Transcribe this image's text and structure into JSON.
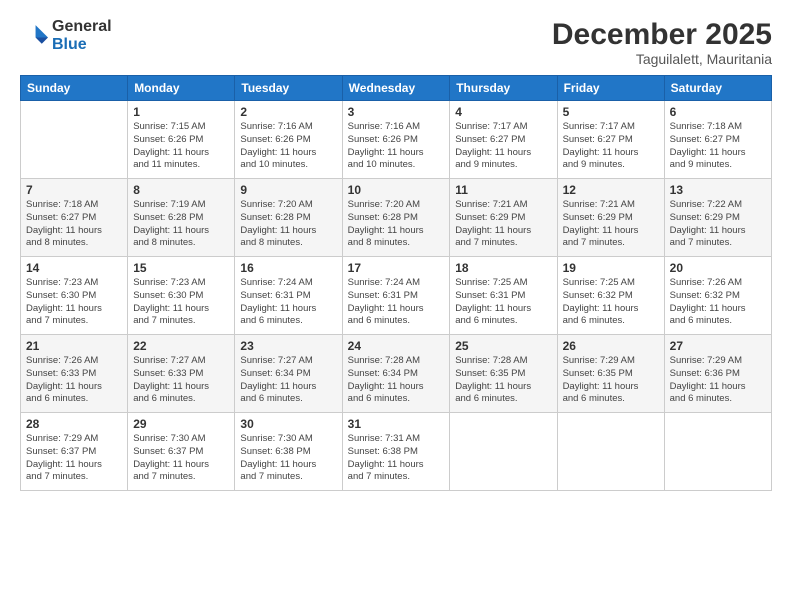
{
  "logo": {
    "general": "General",
    "blue": "Blue"
  },
  "header": {
    "month": "December 2025",
    "location": "Taguilalett, Mauritania"
  },
  "weekdays": [
    "Sunday",
    "Monday",
    "Tuesday",
    "Wednesday",
    "Thursday",
    "Friday",
    "Saturday"
  ],
  "weeks": [
    [
      {
        "day": "",
        "info": ""
      },
      {
        "day": "1",
        "info": "Sunrise: 7:15 AM\nSunset: 6:26 PM\nDaylight: 11 hours\nand 11 minutes."
      },
      {
        "day": "2",
        "info": "Sunrise: 7:16 AM\nSunset: 6:26 PM\nDaylight: 11 hours\nand 10 minutes."
      },
      {
        "day": "3",
        "info": "Sunrise: 7:16 AM\nSunset: 6:26 PM\nDaylight: 11 hours\nand 10 minutes."
      },
      {
        "day": "4",
        "info": "Sunrise: 7:17 AM\nSunset: 6:27 PM\nDaylight: 11 hours\nand 9 minutes."
      },
      {
        "day": "5",
        "info": "Sunrise: 7:17 AM\nSunset: 6:27 PM\nDaylight: 11 hours\nand 9 minutes."
      },
      {
        "day": "6",
        "info": "Sunrise: 7:18 AM\nSunset: 6:27 PM\nDaylight: 11 hours\nand 9 minutes."
      }
    ],
    [
      {
        "day": "7",
        "info": "Sunrise: 7:18 AM\nSunset: 6:27 PM\nDaylight: 11 hours\nand 8 minutes."
      },
      {
        "day": "8",
        "info": "Sunrise: 7:19 AM\nSunset: 6:28 PM\nDaylight: 11 hours\nand 8 minutes."
      },
      {
        "day": "9",
        "info": "Sunrise: 7:20 AM\nSunset: 6:28 PM\nDaylight: 11 hours\nand 8 minutes."
      },
      {
        "day": "10",
        "info": "Sunrise: 7:20 AM\nSunset: 6:28 PM\nDaylight: 11 hours\nand 8 minutes."
      },
      {
        "day": "11",
        "info": "Sunrise: 7:21 AM\nSunset: 6:29 PM\nDaylight: 11 hours\nand 7 minutes."
      },
      {
        "day": "12",
        "info": "Sunrise: 7:21 AM\nSunset: 6:29 PM\nDaylight: 11 hours\nand 7 minutes."
      },
      {
        "day": "13",
        "info": "Sunrise: 7:22 AM\nSunset: 6:29 PM\nDaylight: 11 hours\nand 7 minutes."
      }
    ],
    [
      {
        "day": "14",
        "info": "Sunrise: 7:23 AM\nSunset: 6:30 PM\nDaylight: 11 hours\nand 7 minutes."
      },
      {
        "day": "15",
        "info": "Sunrise: 7:23 AM\nSunset: 6:30 PM\nDaylight: 11 hours\nand 7 minutes."
      },
      {
        "day": "16",
        "info": "Sunrise: 7:24 AM\nSunset: 6:31 PM\nDaylight: 11 hours\nand 6 minutes."
      },
      {
        "day": "17",
        "info": "Sunrise: 7:24 AM\nSunset: 6:31 PM\nDaylight: 11 hours\nand 6 minutes."
      },
      {
        "day": "18",
        "info": "Sunrise: 7:25 AM\nSunset: 6:31 PM\nDaylight: 11 hours\nand 6 minutes."
      },
      {
        "day": "19",
        "info": "Sunrise: 7:25 AM\nSunset: 6:32 PM\nDaylight: 11 hours\nand 6 minutes."
      },
      {
        "day": "20",
        "info": "Sunrise: 7:26 AM\nSunset: 6:32 PM\nDaylight: 11 hours\nand 6 minutes."
      }
    ],
    [
      {
        "day": "21",
        "info": "Sunrise: 7:26 AM\nSunset: 6:33 PM\nDaylight: 11 hours\nand 6 minutes."
      },
      {
        "day": "22",
        "info": "Sunrise: 7:27 AM\nSunset: 6:33 PM\nDaylight: 11 hours\nand 6 minutes."
      },
      {
        "day": "23",
        "info": "Sunrise: 7:27 AM\nSunset: 6:34 PM\nDaylight: 11 hours\nand 6 minutes."
      },
      {
        "day": "24",
        "info": "Sunrise: 7:28 AM\nSunset: 6:34 PM\nDaylight: 11 hours\nand 6 minutes."
      },
      {
        "day": "25",
        "info": "Sunrise: 7:28 AM\nSunset: 6:35 PM\nDaylight: 11 hours\nand 6 minutes."
      },
      {
        "day": "26",
        "info": "Sunrise: 7:29 AM\nSunset: 6:35 PM\nDaylight: 11 hours\nand 6 minutes."
      },
      {
        "day": "27",
        "info": "Sunrise: 7:29 AM\nSunset: 6:36 PM\nDaylight: 11 hours\nand 6 minutes."
      }
    ],
    [
      {
        "day": "28",
        "info": "Sunrise: 7:29 AM\nSunset: 6:37 PM\nDaylight: 11 hours\nand 7 minutes."
      },
      {
        "day": "29",
        "info": "Sunrise: 7:30 AM\nSunset: 6:37 PM\nDaylight: 11 hours\nand 7 minutes."
      },
      {
        "day": "30",
        "info": "Sunrise: 7:30 AM\nSunset: 6:38 PM\nDaylight: 11 hours\nand 7 minutes."
      },
      {
        "day": "31",
        "info": "Sunrise: 7:31 AM\nSunset: 6:38 PM\nDaylight: 11 hours\nand 7 minutes."
      },
      {
        "day": "",
        "info": ""
      },
      {
        "day": "",
        "info": ""
      },
      {
        "day": "",
        "info": ""
      }
    ]
  ]
}
